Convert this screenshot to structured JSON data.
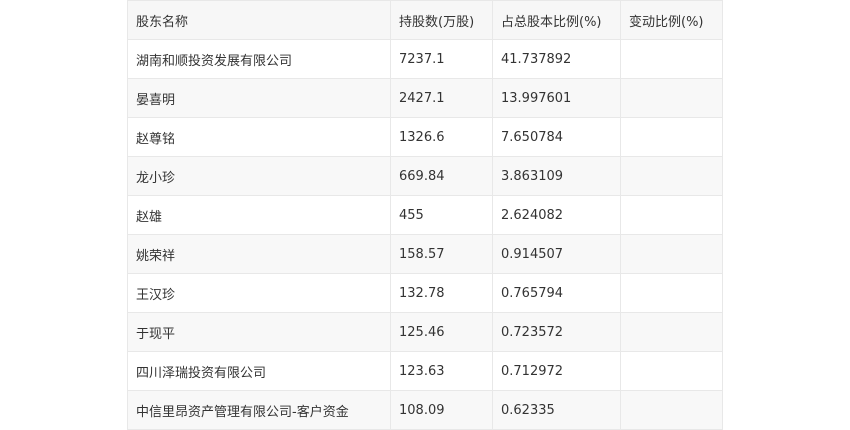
{
  "table": {
    "headers": [
      "股东名称",
      "持股数(万股)",
      "占总股本比例(%)",
      "变动比例(%)"
    ],
    "rows": [
      [
        "湖南和顺投资发展有限公司",
        "7237.1",
        "41.737892",
        ""
      ],
      [
        "晏喜明",
        "2427.1",
        "13.997601",
        ""
      ],
      [
        "赵尊铭",
        "1326.6",
        "7.650784",
        ""
      ],
      [
        "龙小珍",
        "669.84",
        "3.863109",
        ""
      ],
      [
        "赵雄",
        "455",
        "2.624082",
        ""
      ],
      [
        "姚荣祥",
        "158.57",
        "0.914507",
        ""
      ],
      [
        "王汉珍",
        "132.78",
        "0.765794",
        ""
      ],
      [
        "于现平",
        "125.46",
        "0.723572",
        ""
      ],
      [
        "四川泽瑞投资有限公司",
        "123.63",
        "0.712972",
        ""
      ],
      [
        "中信里昂资产管理有限公司-客户资金",
        "108.09",
        "0.62335",
        ""
      ]
    ]
  }
}
